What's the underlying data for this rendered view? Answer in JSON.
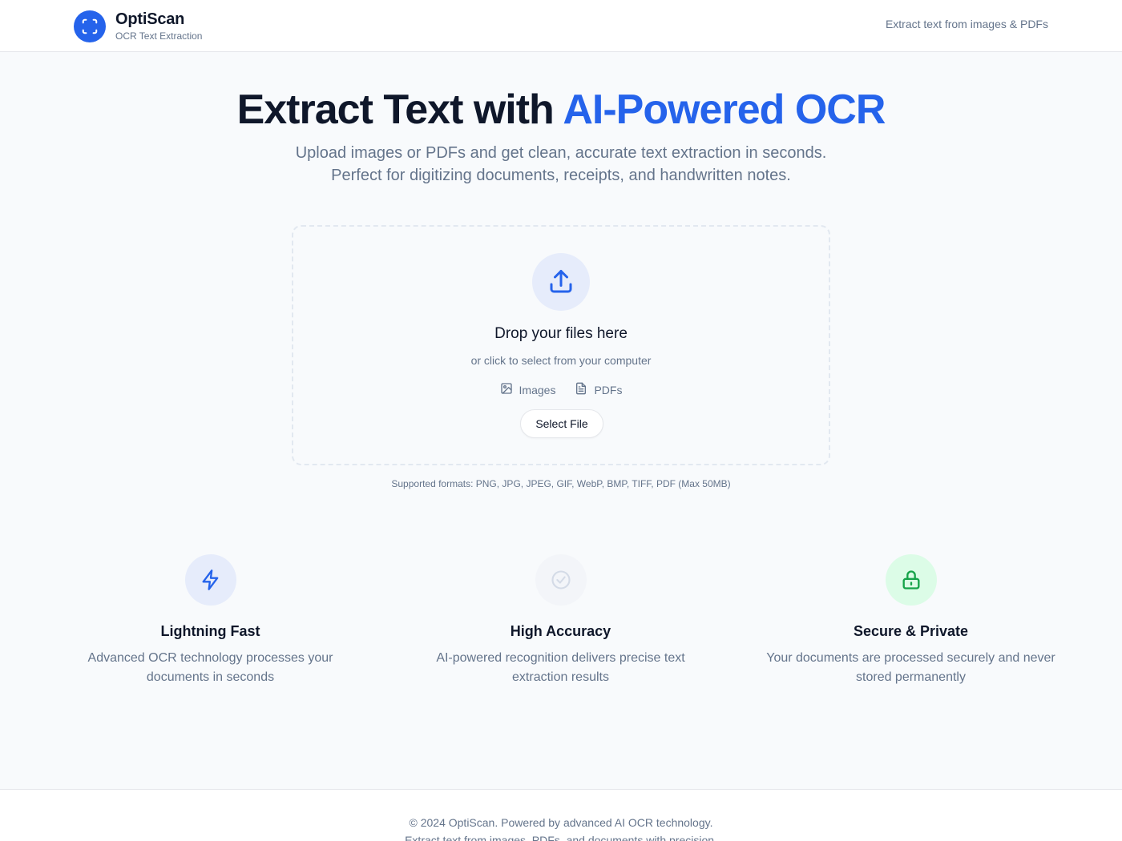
{
  "header": {
    "brand_name": "OptiScan",
    "brand_subtitle": "OCR Text Extraction",
    "tagline": "Extract text from images & PDFs",
    "logo_icon": "scan-frame-icon"
  },
  "hero": {
    "title_plain": "Extract Text with ",
    "title_accent": "AI-Powered OCR",
    "subtitle_line1": "Upload images or PDFs and get clean, accurate text extraction in seconds.",
    "subtitle_line2": "Perfect for digitizing documents, receipts, and handwritten notes."
  },
  "dropzone": {
    "icon": "upload-icon",
    "title": "Drop your files here",
    "subtitle": "or click to select from your computer",
    "file_types": [
      {
        "icon": "image-icon",
        "label": "Images"
      },
      {
        "icon": "document-icon",
        "label": "PDFs"
      }
    ],
    "button_label": "Select File",
    "formats_note": "Supported formats: PNG, JPG, JPEG, GIF, WebP, BMP, TIFF, PDF (Max 50MB)"
  },
  "features": [
    {
      "icon": "lightning-icon",
      "title": "Lightning Fast",
      "desc_line1": "Advanced OCR technology processes your",
      "desc_line2": "documents in seconds",
      "icon_bg": "#e6ecfb",
      "icon_color": "#2563eb"
    },
    {
      "icon": "check-circle-icon",
      "title": "High Accuracy",
      "desc_line1": "AI-powered recognition delivers precise text",
      "desc_line2": "extraction results",
      "icon_bg": "#f3f5f9",
      "icon_color": "#d4dbe7"
    },
    {
      "icon": "lock-icon",
      "title": "Secure & Private",
      "desc_line1": "Your documents are processed securely and never",
      "desc_line2": "stored permanently",
      "icon_bg": "#dcfce7",
      "icon_color": "#16a34a"
    }
  ],
  "footer": {
    "copyright": "© 2024 OptiScan. Powered by advanced AI OCR technology.",
    "tagline": "Extract text from images, PDFs, and documents with precision."
  },
  "colors": {
    "accent": "#2563eb",
    "text": "#0f172a",
    "muted": "#64748b",
    "background": "#f8fafc"
  }
}
